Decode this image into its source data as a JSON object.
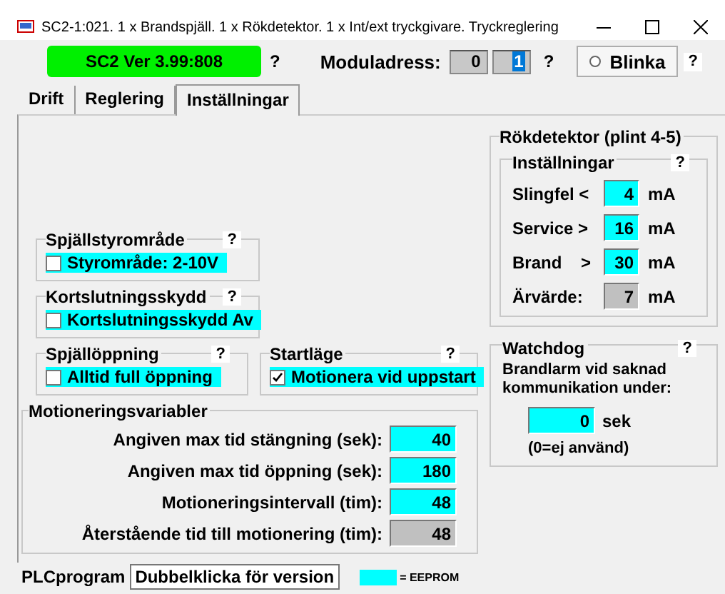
{
  "window": {
    "title": "SC2-1:021. 1 x Brandspjäll. 1 x Rökdetektor. 1 x Int/ext tryckgivare. Tryckreglering"
  },
  "toolbar": {
    "version": "SC2 Ver 3.99:808",
    "version_help": "?",
    "address_label": "Moduladress:",
    "address_fields": [
      {
        "value": "0",
        "selected": false
      },
      {
        "value": "1",
        "selected": true
      }
    ],
    "address_help": "?",
    "blink": {
      "label": "Blinka",
      "selected": false
    },
    "blink_help": "?"
  },
  "tabs": [
    {
      "label": "Drift",
      "selected": false
    },
    {
      "label": "Reglering",
      "selected": false
    },
    {
      "label": "Inställningar",
      "selected": true
    }
  ],
  "option_groups": [
    {
      "title": "Spjällstyrområde",
      "help": "?",
      "label": "Styrområde:  2-10V",
      "checked": false
    },
    {
      "title": "Kortslutningsskydd",
      "help": "?",
      "label": "Kortslutningsskydd Av",
      "checked": false
    }
  ],
  "option_pairs": [
    {
      "title": "Spjällöppning",
      "help": "?",
      "label": "Alltid full öppning",
      "checked": false
    },
    {
      "title": "Startläge",
      "help": "?",
      "label": "Motionera vid uppstart",
      "checked": true
    }
  ],
  "exercise": {
    "title": "Motioneringsvariabler",
    "rows": [
      {
        "label": "Angiven max tid stängning (sek):",
        "value": "40",
        "kind": "eeprom"
      },
      {
        "label": "Angiven max tid öppning (sek):",
        "value": "180",
        "kind": "eeprom"
      },
      {
        "label": "Motioneringsintervall (tim):",
        "value": "48",
        "kind": "eeprom"
      },
      {
        "label": "Återstående tid till motionering (tim):",
        "value": "48",
        "kind": "readonly"
      }
    ]
  },
  "smoke_detector": {
    "title": "Rökdetektor (plint 4-5)",
    "settings_title": "Inställningar",
    "help": "?",
    "rows": [
      {
        "label": "Slingfel <",
        "value": "4",
        "unit": "mA",
        "kind": "eeprom"
      },
      {
        "label": "Service >",
        "value": "16",
        "unit": "mA",
        "kind": "eeprom"
      },
      {
        "label": "Brand    >",
        "value": "30",
        "unit": "mA",
        "kind": "eeprom"
      },
      {
        "label": "Ärvärde:",
        "value": "7",
        "unit": "mA",
        "kind": "readonly"
      }
    ]
  },
  "watchdog": {
    "title": "Watchdog",
    "help": "?",
    "text": "Brandlarm vid saknad kommunikation under:",
    "value": "0",
    "unit": "sek",
    "note": "(0=ej använd)"
  },
  "footer": {
    "label": "PLCprogram",
    "value": "Dubbelklicka för version",
    "legend": "= EEPROM"
  }
}
